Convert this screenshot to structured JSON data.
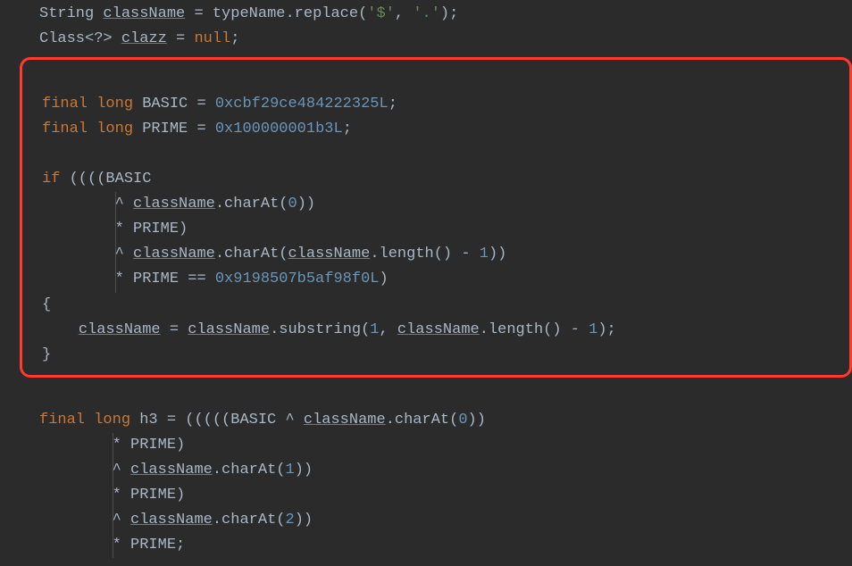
{
  "code": {
    "l1": {
      "t1": "String ",
      "v1": "className",
      "t2": " = typeName.replace(",
      "s1": "'$'",
      "t3": ", ",
      "s2": "'.'",
      "t4": ");"
    },
    "l2": {
      "t1": "Class<?> ",
      "v1": "clazz",
      "t2": " = ",
      "kw": "null",
      "t3": ";"
    },
    "l3": {
      "kw1": "final",
      "sp1": " ",
      "kw2": "long",
      "t1": " BASIC = ",
      "n1": "0xcbf29ce484222325L",
      "t2": ";"
    },
    "l4": {
      "kw1": "final",
      "sp1": " ",
      "kw2": "long",
      "t1": " PRIME = ",
      "n1": "0x100000001b3L",
      "t2": ";"
    },
    "l5": {
      "kw": "if",
      "t1": " ((((BASIC"
    },
    "l6": {
      "pad": "        ",
      "t1": "^ ",
      "v1": "className",
      "t2": ".charAt(",
      "n1": "0",
      "t3": "))"
    },
    "l7": {
      "pad": "        ",
      "t1": "* PRIME)"
    },
    "l8": {
      "pad": "        ",
      "t1": "^ ",
      "v1": "className",
      "t2": ".charAt(",
      "v2": "className",
      "t3": ".length() - ",
      "n1": "1",
      "t4": "))"
    },
    "l9": {
      "pad": "        ",
      "t1": "* PRIME == ",
      "n1": "0x9198507b5af98f0L",
      "t2": ")"
    },
    "l10": {
      "t1": "{"
    },
    "l11": {
      "pad": "    ",
      "v1": "className",
      "t1": " = ",
      "v2": "className",
      "t2": ".substring(",
      "n1": "1",
      "t3": ", ",
      "v3": "className",
      "t4": ".length() - ",
      "n2": "1",
      "t5": ");"
    },
    "l12": {
      "t1": "}"
    },
    "l13": {
      "kw1": "final",
      "sp1": " ",
      "kw2": "long",
      "t1": " h3 = (((((BASIC ^ ",
      "v1": "className",
      "t2": ".charAt(",
      "n1": "0",
      "t3": "))"
    },
    "l14": {
      "pad": "        ",
      "t1": "* PRIME)"
    },
    "l15": {
      "pad": "        ",
      "t1": "^ ",
      "v1": "className",
      "t2": ".charAt(",
      "n1": "1",
      "t3": "))"
    },
    "l16": {
      "pad": "        ",
      "t1": "* PRIME)"
    },
    "l17": {
      "pad": "        ",
      "t1": "^ ",
      "v1": "className",
      "t2": ".charAt(",
      "n1": "2",
      "t3": "))"
    },
    "l18": {
      "pad": "        ",
      "t1": "* PRIME;"
    }
  }
}
